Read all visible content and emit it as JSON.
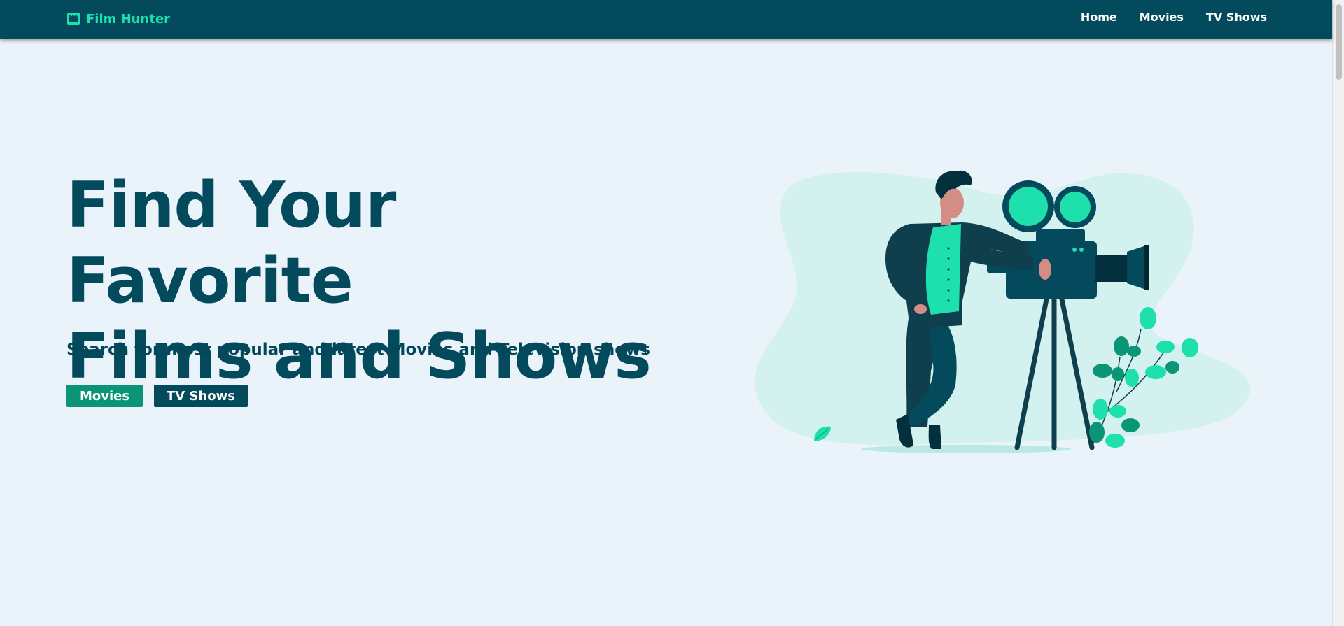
{
  "navbar": {
    "brand": "Film Hunter",
    "brand_icon": "film-clapper-icon",
    "links": [
      {
        "label": "Home"
      },
      {
        "label": "Movies"
      },
      {
        "label": "TV Shows"
      }
    ],
    "background": "#034a5d",
    "brand_color": "#1ee0ac"
  },
  "hero": {
    "title_line1": "Find Your Favorite",
    "title_line2": "Films and Shows",
    "subtitle": "Search for most popular and latest Movies and Television shows",
    "buttons": {
      "movies": "Movies",
      "tv_shows": "TV Shows"
    },
    "illustration": "man-with-film-camera-illustration"
  },
  "colors": {
    "page_background": "#eaf3f9",
    "primary": "#034a5d",
    "accent": "#0b9577",
    "highlight": "#1ee0ac"
  }
}
